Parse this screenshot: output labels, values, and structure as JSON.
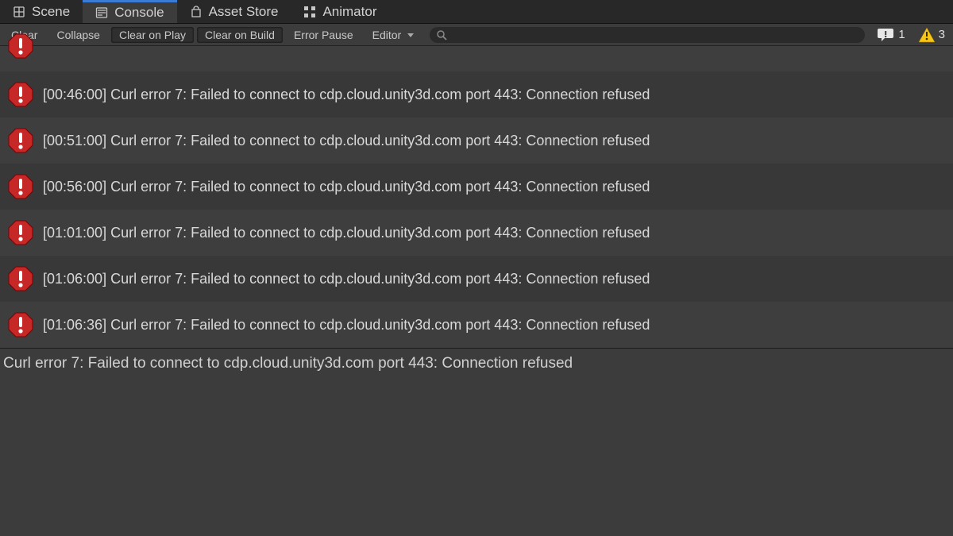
{
  "tabs": {
    "scene": "Scene",
    "console": "Console",
    "asset_store": "Asset Store",
    "animator": "Animator",
    "active": "console"
  },
  "toolbar": {
    "clear": "Clear",
    "collapse": "Collapse",
    "clear_on_play": "Clear on Play",
    "clear_on_build": "Clear on Build",
    "error_pause": "Error Pause",
    "editor": "Editor",
    "search_placeholder": ""
  },
  "counters": {
    "info": "1",
    "warning": "3"
  },
  "log_entries": [
    {
      "time": "",
      "msg": "",
      "partial": true
    },
    {
      "time": "[00:46:00]",
      "msg": "Curl error 7: Failed to connect to cdp.cloud.unity3d.com port 443: Connection refused"
    },
    {
      "time": "[00:51:00]",
      "msg": "Curl error 7: Failed to connect to cdp.cloud.unity3d.com port 443: Connection refused"
    },
    {
      "time": "[00:56:00]",
      "msg": "Curl error 7: Failed to connect to cdp.cloud.unity3d.com port 443: Connection refused"
    },
    {
      "time": "[01:01:00]",
      "msg": "Curl error 7: Failed to connect to cdp.cloud.unity3d.com port 443: Connection refused"
    },
    {
      "time": "[01:06:00]",
      "msg": "Curl error 7: Failed to connect to cdp.cloud.unity3d.com port 443: Connection refused"
    },
    {
      "time": "[01:06:36]",
      "msg": "Curl error 7: Failed to connect to cdp.cloud.unity3d.com port 443: Connection refused"
    }
  ],
  "detail": "Curl error 7: Failed to connect to cdp.cloud.unity3d.com port 443: Connection refused"
}
